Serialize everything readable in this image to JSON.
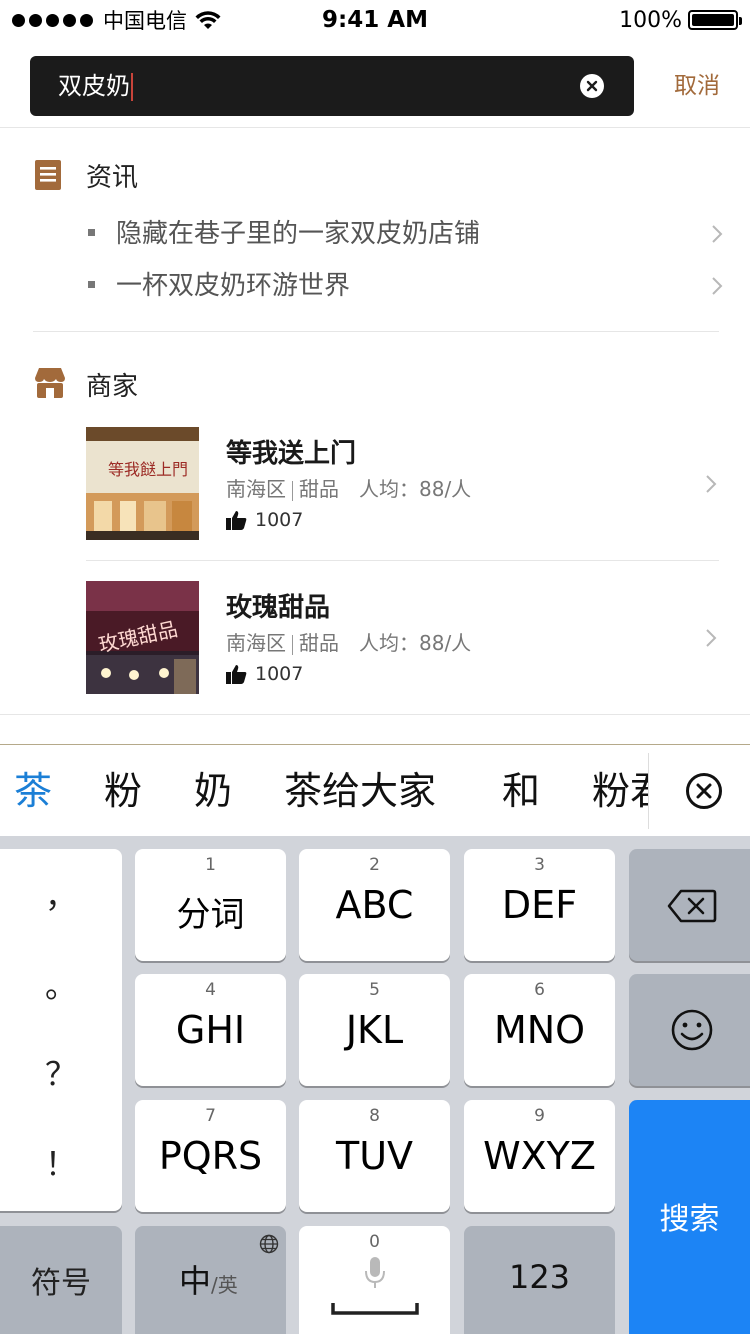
{
  "status_bar": {
    "carrier": "中国电信",
    "time": "9:41 AM",
    "battery": "100%"
  },
  "search": {
    "query": "双皮奶",
    "cancel_label": "取消"
  },
  "news": {
    "title": "资讯",
    "items": [
      "隐藏在巷子里的一家双皮奶店铺",
      "一杯双皮奶环游世界"
    ]
  },
  "merchants": {
    "title": "商家",
    "items": [
      {
        "name": "等我送上门",
        "district": "南海区",
        "category": "甜品",
        "avg_price": "人均：88/人",
        "likes": "1007"
      },
      {
        "name": "玫瑰甜品",
        "district": "南海区",
        "category": "甜品",
        "avg_price": "人均：88/人",
        "likes": "1007"
      }
    ]
  },
  "candidates": [
    "茶",
    "粉",
    "奶",
    "茶给大家",
    "和",
    "粉君"
  ],
  "keyboard": {
    "punctuation": [
      "，",
      "。",
      "？",
      "！"
    ],
    "keys": [
      {
        "num": "1",
        "label": "分词"
      },
      {
        "num": "2",
        "label": "ABC"
      },
      {
        "num": "3",
        "label": "DEF"
      },
      {
        "num": "4",
        "label": "GHI"
      },
      {
        "num": "5",
        "label": "JKL"
      },
      {
        "num": "6",
        "label": "MNO"
      },
      {
        "num": "7",
        "label": "PQRS"
      },
      {
        "num": "8",
        "label": "TUV"
      },
      {
        "num": "9",
        "label": "WXYZ"
      }
    ],
    "symbol_label": "符号",
    "lang_main": "中",
    "lang_sub": "/英",
    "space_num": "0",
    "number_label": "123",
    "search_label": "搜索"
  },
  "colors": {
    "accent": "#a26a3b",
    "candidate_active": "#1b7fd6",
    "search_key": "#1c84f5"
  }
}
